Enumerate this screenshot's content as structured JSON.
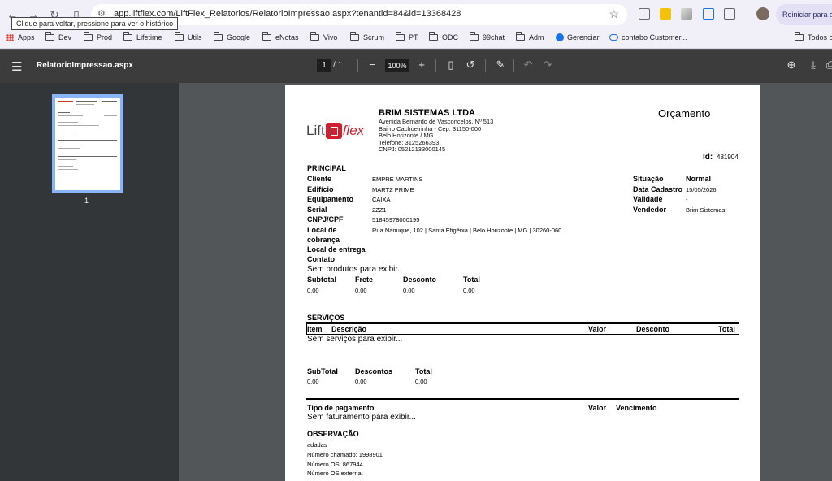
{
  "browser": {
    "url": "app.liftflex.com/LiftFlex_Relatorios/RelatorioImpressao.aspx?tenantid=84&id=13368428",
    "tooltip": "Clique para voltar, pressione para ver o histórico",
    "reset_label": "Reiniciar para at",
    "bookmarks": [
      "Apps",
      "Dev",
      "Prod",
      "Lifetime",
      "Utils",
      "Google",
      "eNotas",
      "Vivo",
      "Scrum",
      "PT",
      "ODC",
      "99chat",
      "Adm",
      "Gerenciar",
      "contabo Customer...",
      "Todos os"
    ]
  },
  "viewer": {
    "title": "RelatorioImpressao.aspx",
    "page_current": "1",
    "page_total": "/  1",
    "zoom": "100%",
    "thumb_number": "1"
  },
  "doc": {
    "company_name": "BRIM SISTEMAS LTDA",
    "company_address": "Avenida Bernardo de Vasconcelos, Nº 513",
    "company_district": "Bairro Cachoeirinha - Cep: 31150-000",
    "company_city": "Belo Horizonte / MG",
    "company_phone": "Telefone: 3125266393",
    "company_cnpj": "CNPJ: 05212133000145",
    "kind": "Orçamento",
    "logo_left": "Lift",
    "logo_right": "flex",
    "id_label": "Id:",
    "id_value": "481904",
    "principal": {
      "heading": "PRINCIPAL",
      "cliente_label": "Cliente",
      "cliente": "EMPRE MARTINS",
      "edificio_label": "Edifício",
      "edificio": "MARTZ PRIME",
      "equipamento_label": "Equipamento",
      "equipamento": "CAIXA",
      "serial_label": "Serial",
      "serial": "2ZZ1",
      "cnpj_label": "CNPJ/CPF",
      "cnpj": "51845978000195",
      "local_cobranca_label_1": "Local de",
      "local_cobranca_label_2": "cobrança",
      "local_cobranca": "Rua Nanuque, 102 | Santa Efigênia | Belo Horizonte | MG | 30260-060",
      "local_entrega_label": "Local de entrega",
      "contato_label": "Contato",
      "situacao_label": "Situação",
      "situacao": "Normal",
      "data_cadastro_label": "Data Cadastro",
      "data_cadastro": "15/05/2026",
      "validade_label": "Validade",
      "validade": "-",
      "vendedor_label": "Vendedor",
      "vendedor": "Brim Sistemas"
    },
    "produtos": {
      "empty": "Sem produtos para exibir..",
      "subtotal_label": "Subtotal",
      "subtotal": "0,00",
      "frete_label": "Frete",
      "frete": "0,00",
      "desconto_label": "Desconto",
      "desconto": "0,00",
      "total_label": "Total",
      "total": "0,00"
    },
    "servicos": {
      "heading": "SERVIÇOS",
      "col_item": "Item",
      "col_descricao": "Descrição",
      "col_valor": "Valor",
      "col_desconto": "Desconto",
      "col_total": "Total",
      "empty": "Sem serviços para exibir...",
      "subtotal_label": "SubTotal",
      "subtotal": "0,00",
      "descontos_label": "Descontos",
      "descontos": "0,00",
      "total_label": "Total",
      "total": "0,00"
    },
    "pagamento": {
      "tipo_label": "Tipo de pagamento",
      "valor_label": "Valor",
      "vencimento_label": "Vencimento",
      "empty": "Sem faturamento para exibir..."
    },
    "observacao": {
      "heading": "OBSERVAÇÃO",
      "line1": "adadas",
      "line2": "Número chamado: 1998901",
      "line3": "Número OS: 867944",
      "line4": "Número OS externa:"
    }
  }
}
